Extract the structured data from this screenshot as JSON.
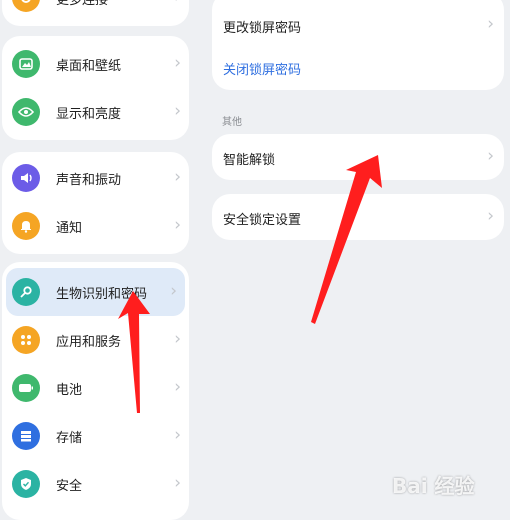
{
  "left_menu": {
    "top_partial_item": {
      "label": "更多连接",
      "color": "#f5a524"
    },
    "items": [
      {
        "label": "桌面和壁纸",
        "icon": "image-icon",
        "color": "#3fb86d"
      },
      {
        "label": "显示和亮度",
        "icon": "eye-icon",
        "color": "#3fb86d"
      },
      {
        "label": "声音和振动",
        "icon": "speaker-icon",
        "color": "#6c5ce7"
      },
      {
        "label": "通知",
        "icon": "bell-icon",
        "color": "#f5a524"
      },
      {
        "label": "生物识别和密码",
        "icon": "key-icon",
        "color": "#2bb3a3"
      },
      {
        "label": "应用和服务",
        "icon": "apps-icon",
        "color": "#f5a524"
      },
      {
        "label": "电池",
        "icon": "battery-icon",
        "color": "#3fb86d"
      },
      {
        "label": "存储",
        "icon": "storage-icon",
        "color": "#2f6fe0"
      },
      {
        "label": "安全",
        "icon": "shield-icon",
        "color": "#2bb3a3"
      }
    ]
  },
  "right_panel": {
    "change_lock_password": "更改锁屏密码",
    "disable_lock_password": "关闭锁屏密码",
    "other_section_header": "其他",
    "smart_unlock": "智能解锁",
    "security_lock_settings": "安全锁定设置"
  },
  "watermark": "Bai 经验",
  "colors": {
    "accent": "#2f6fe0",
    "arrow": "#ff1e1e",
    "selected_bg": "#dfeaf8"
  }
}
